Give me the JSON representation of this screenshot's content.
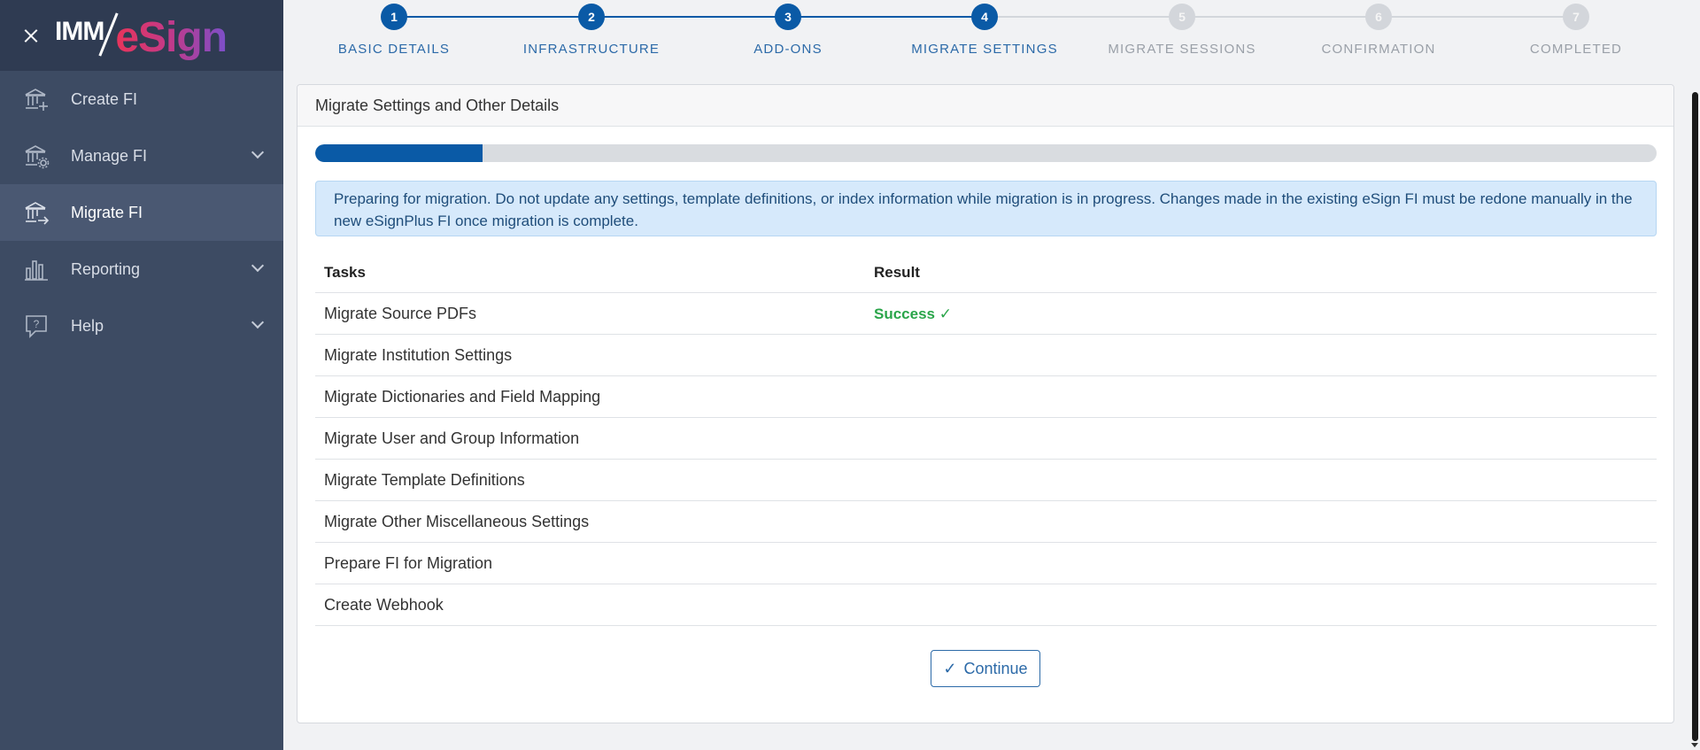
{
  "sidebar": {
    "logo_imm": "IMM",
    "logo_esign": "eSign",
    "items": [
      {
        "label": "Create FI",
        "icon": "bank-plus-icon"
      },
      {
        "label": "Manage FI",
        "icon": "bank-gear-icon"
      },
      {
        "label": "Migrate FI",
        "icon": "bank-arrow-icon"
      },
      {
        "label": "Reporting",
        "icon": "bar-chart-icon"
      },
      {
        "label": "Help",
        "icon": "help-bubble-icon"
      }
    ]
  },
  "stepper": {
    "steps": [
      {
        "num": "1",
        "label": "BASIC DETAILS"
      },
      {
        "num": "2",
        "label": "INFRASTRUCTURE"
      },
      {
        "num": "3",
        "label": "ADD-ONS"
      },
      {
        "num": "4",
        "label": "MIGRATE SETTINGS"
      },
      {
        "num": "5",
        "label": "MIGRATE SESSIONS"
      },
      {
        "num": "6",
        "label": "CONFIRMATION"
      },
      {
        "num": "7",
        "label": "COMPLETED"
      }
    ],
    "current_step": 4
  },
  "card": {
    "title": "Migrate Settings and Other Details",
    "progress_fraction": 0.125,
    "alert_text": "Preparing for migration. Do not update any settings, template definitions, or index information while migration is in progress. Changes made in the existing eSign FI must be redone manually in the new eSignPlus FI once migration is complete.",
    "table": {
      "col_tasks": "Tasks",
      "col_result": "Result",
      "rows": [
        {
          "task": "Migrate Source PDFs",
          "result": "Success"
        },
        {
          "task": "Migrate Institution Settings",
          "result": ""
        },
        {
          "task": "Migrate Dictionaries and Field Mapping",
          "result": ""
        },
        {
          "task": "Migrate User and Group Information",
          "result": ""
        },
        {
          "task": "Migrate Template Definitions",
          "result": ""
        },
        {
          "task": "Migrate Other Miscellaneous Settings",
          "result": ""
        },
        {
          "task": "Prepare FI for Migration",
          "result": ""
        },
        {
          "task": "Create Webhook",
          "result": ""
        }
      ]
    },
    "continue_label": "Continue"
  },
  "colors": {
    "primary": "#0a5aa6",
    "success": "#2aa54a",
    "sidebar_bg": "#3d4b63"
  }
}
